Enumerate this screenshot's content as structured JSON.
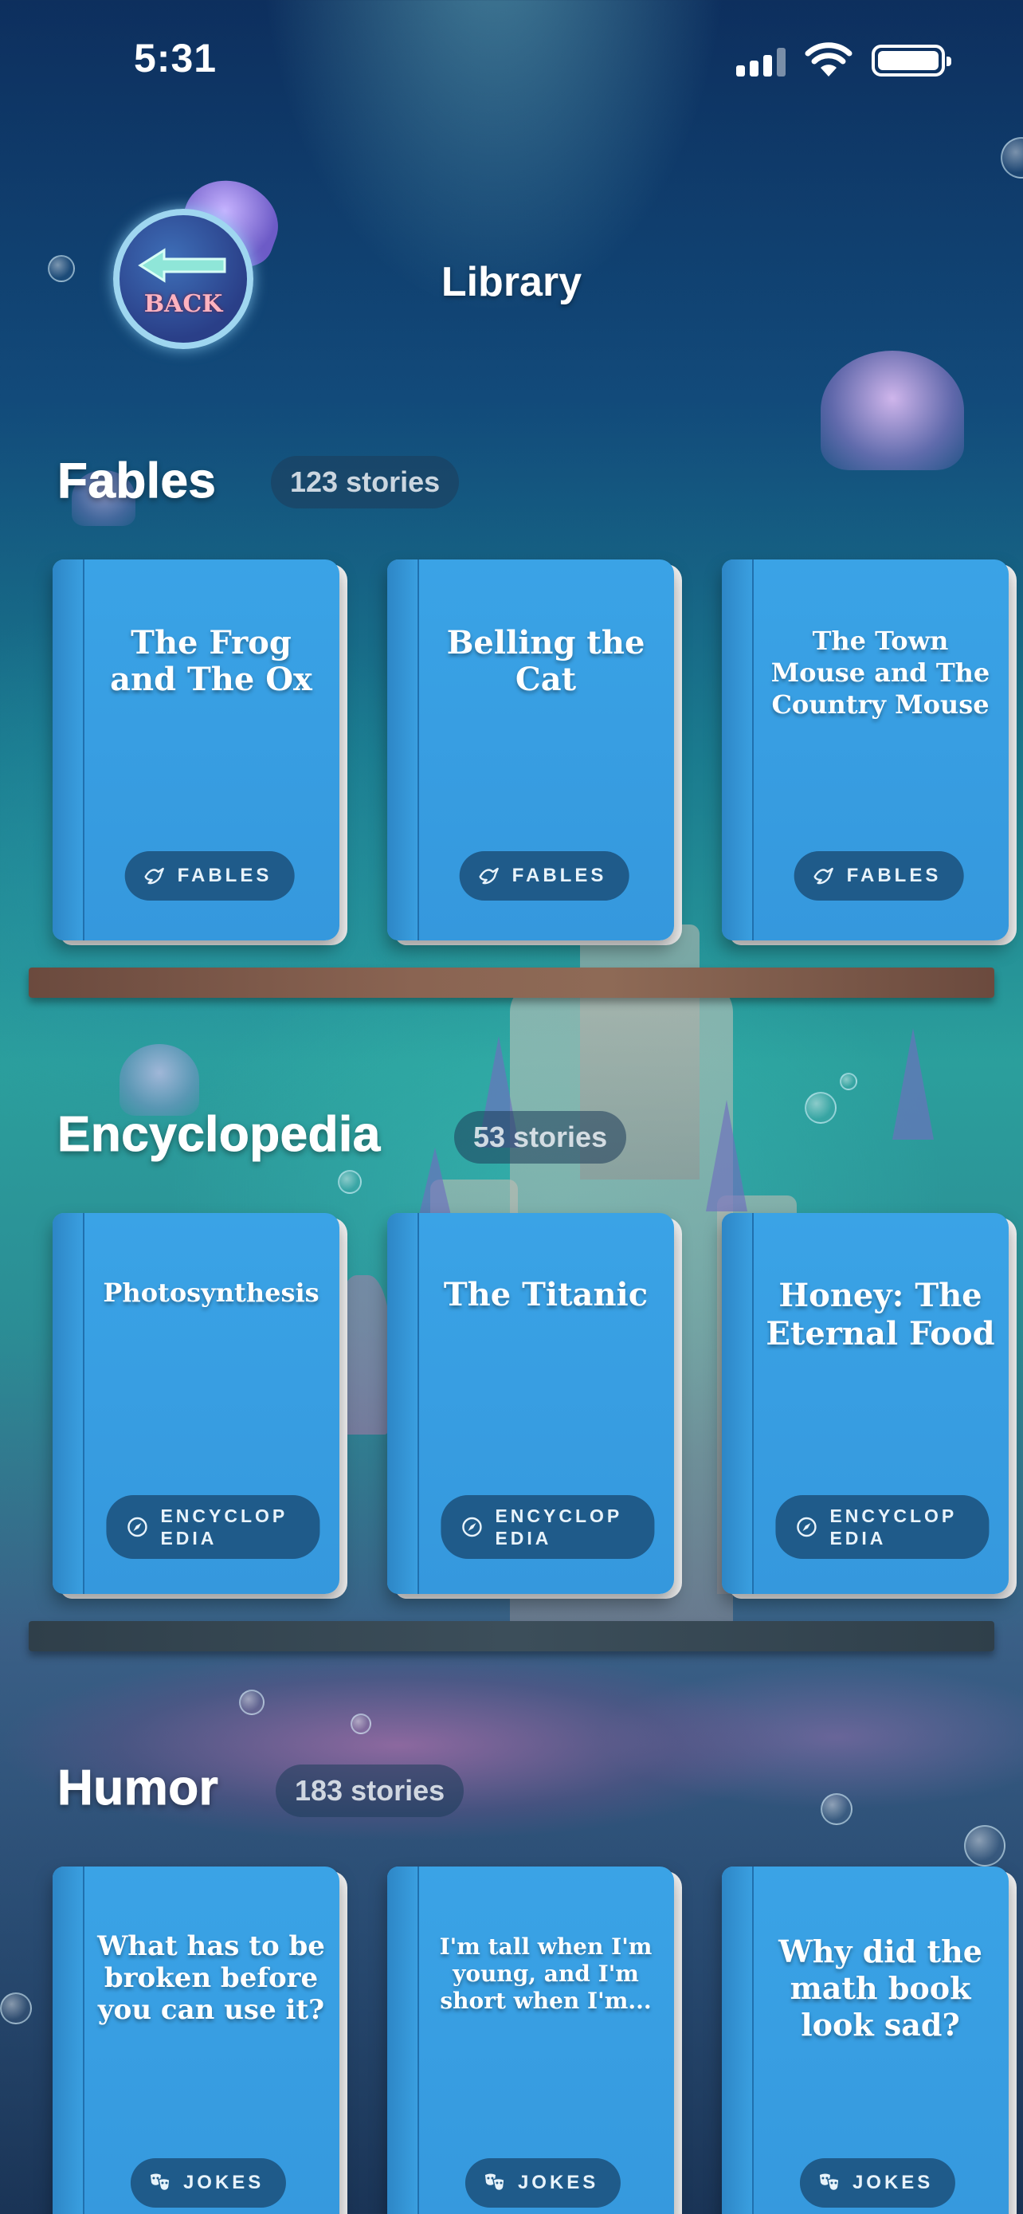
{
  "status_bar": {
    "time": "5:31"
  },
  "header": {
    "back_label": "BACK",
    "title": "Library"
  },
  "sections": [
    {
      "heading": "Fables",
      "count": "123 stories",
      "books": [
        {
          "title": "The Frog and The Ox",
          "tag": "FABLES",
          "tag_icon": "bird-icon"
        },
        {
          "title": "Belling the Cat",
          "tag": "FABLES",
          "tag_icon": "bird-icon"
        },
        {
          "title": "The Town Mouse and The Country Mouse",
          "tag": "FABLES",
          "tag_icon": "bird-icon"
        }
      ]
    },
    {
      "heading": "Encyclopedia",
      "count": "53 stories",
      "books": [
        {
          "title": "Photosynthesis",
          "tag": "ENCYCLOPEDIA",
          "tag_icon": "compass-icon"
        },
        {
          "title": "The Titanic",
          "tag": "ENCYCLOPEDIA",
          "tag_icon": "compass-icon"
        },
        {
          "title": "Honey: The Eternal Food",
          "tag": "ENCYCLOPEDIA",
          "tag_icon": "compass-icon"
        }
      ]
    },
    {
      "heading": "Humor",
      "count": "183 stories",
      "books": [
        {
          "title": "What has to be broken before you can use it?",
          "tag": "JOKES",
          "tag_icon": "masks-icon"
        },
        {
          "title": "I'm tall when I'm young, and I'm short when I'm...",
          "tag": "JOKES",
          "tag_icon": "masks-icon"
        },
        {
          "title": "Why did the math book look sad?",
          "tag": "JOKES",
          "tag_icon": "masks-icon"
        }
      ]
    }
  ],
  "colors": {
    "book_cover": "#3aa3e6",
    "tag_background": "#1f5b8a",
    "shelf_wood": "#7a5646",
    "shelf_slate": "#354652"
  }
}
